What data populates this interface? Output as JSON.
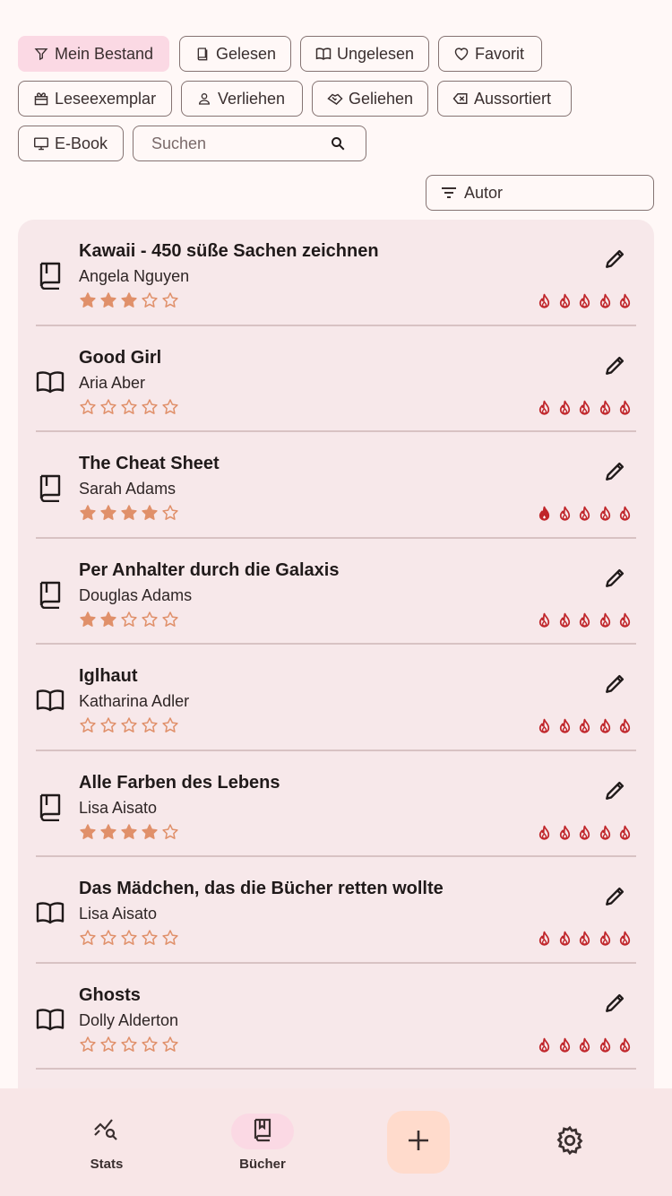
{
  "filters": {
    "row1": [
      {
        "label": "Mein Bestand",
        "icon": "funnel-icon",
        "selected": true
      },
      {
        "label": "Gelesen",
        "icon": "book-closed-icon",
        "selected": false
      },
      {
        "label": "Ungelesen",
        "icon": "book-open-icon",
        "selected": false
      },
      {
        "label": "Favorit",
        "icon": "heart-icon",
        "selected": false
      }
    ],
    "row2": [
      {
        "label": "Leseexemplar",
        "icon": "gift-icon",
        "selected": false
      },
      {
        "label": "Verliehen",
        "icon": "person-icon",
        "selected": false
      },
      {
        "label": "Geliehen",
        "icon": "handshake-icon",
        "selected": false
      },
      {
        "label": "Aussortiert",
        "icon": "backspace-icon",
        "selected": false
      }
    ],
    "row3": [
      {
        "label": "E-Book",
        "icon": "monitor-icon",
        "selected": false
      }
    ]
  },
  "search": {
    "placeholder": "Suchen"
  },
  "sort": {
    "label": "Autor"
  },
  "books": [
    {
      "title": "Kawaii - 450 süße Sachen zeichnen",
      "author": "Angela Nguyen",
      "status": "read",
      "rating": 3,
      "spice": 0
    },
    {
      "title": "Good Girl",
      "author": "Aria Aber",
      "status": "unread",
      "rating": 0,
      "spice": 0
    },
    {
      "title": "The Cheat Sheet",
      "author": "Sarah Adams",
      "status": "read",
      "rating": 4,
      "spice": 1
    },
    {
      "title": "Per Anhalter durch die Galaxis",
      "author": "Douglas Adams",
      "status": "read",
      "rating": 2,
      "spice": 0
    },
    {
      "title": "Iglhaut",
      "author": "Katharina Adler",
      "status": "unread",
      "rating": 0,
      "spice": 0
    },
    {
      "title": "Alle Farben des Lebens",
      "author": "Lisa Aisato",
      "status": "read",
      "rating": 4,
      "spice": 0
    },
    {
      "title": "Das Mädchen, das die Bücher retten wollte",
      "author": "Lisa Aisato",
      "status": "unread",
      "rating": 0,
      "spice": 0
    },
    {
      "title": "Ghosts",
      "author": "Dolly Alderton",
      "status": "unread",
      "rating": 0,
      "spice": 0
    }
  ],
  "nav": {
    "stats_label": "Stats",
    "books_label": "Bücher",
    "add_icon": "plus-icon",
    "settings_icon": "gear-icon"
  },
  "colors": {
    "accent_pink": "#fbd9e4",
    "star": "#e0906a",
    "spice": "#c0262b",
    "fab": "#ffdbcc"
  }
}
